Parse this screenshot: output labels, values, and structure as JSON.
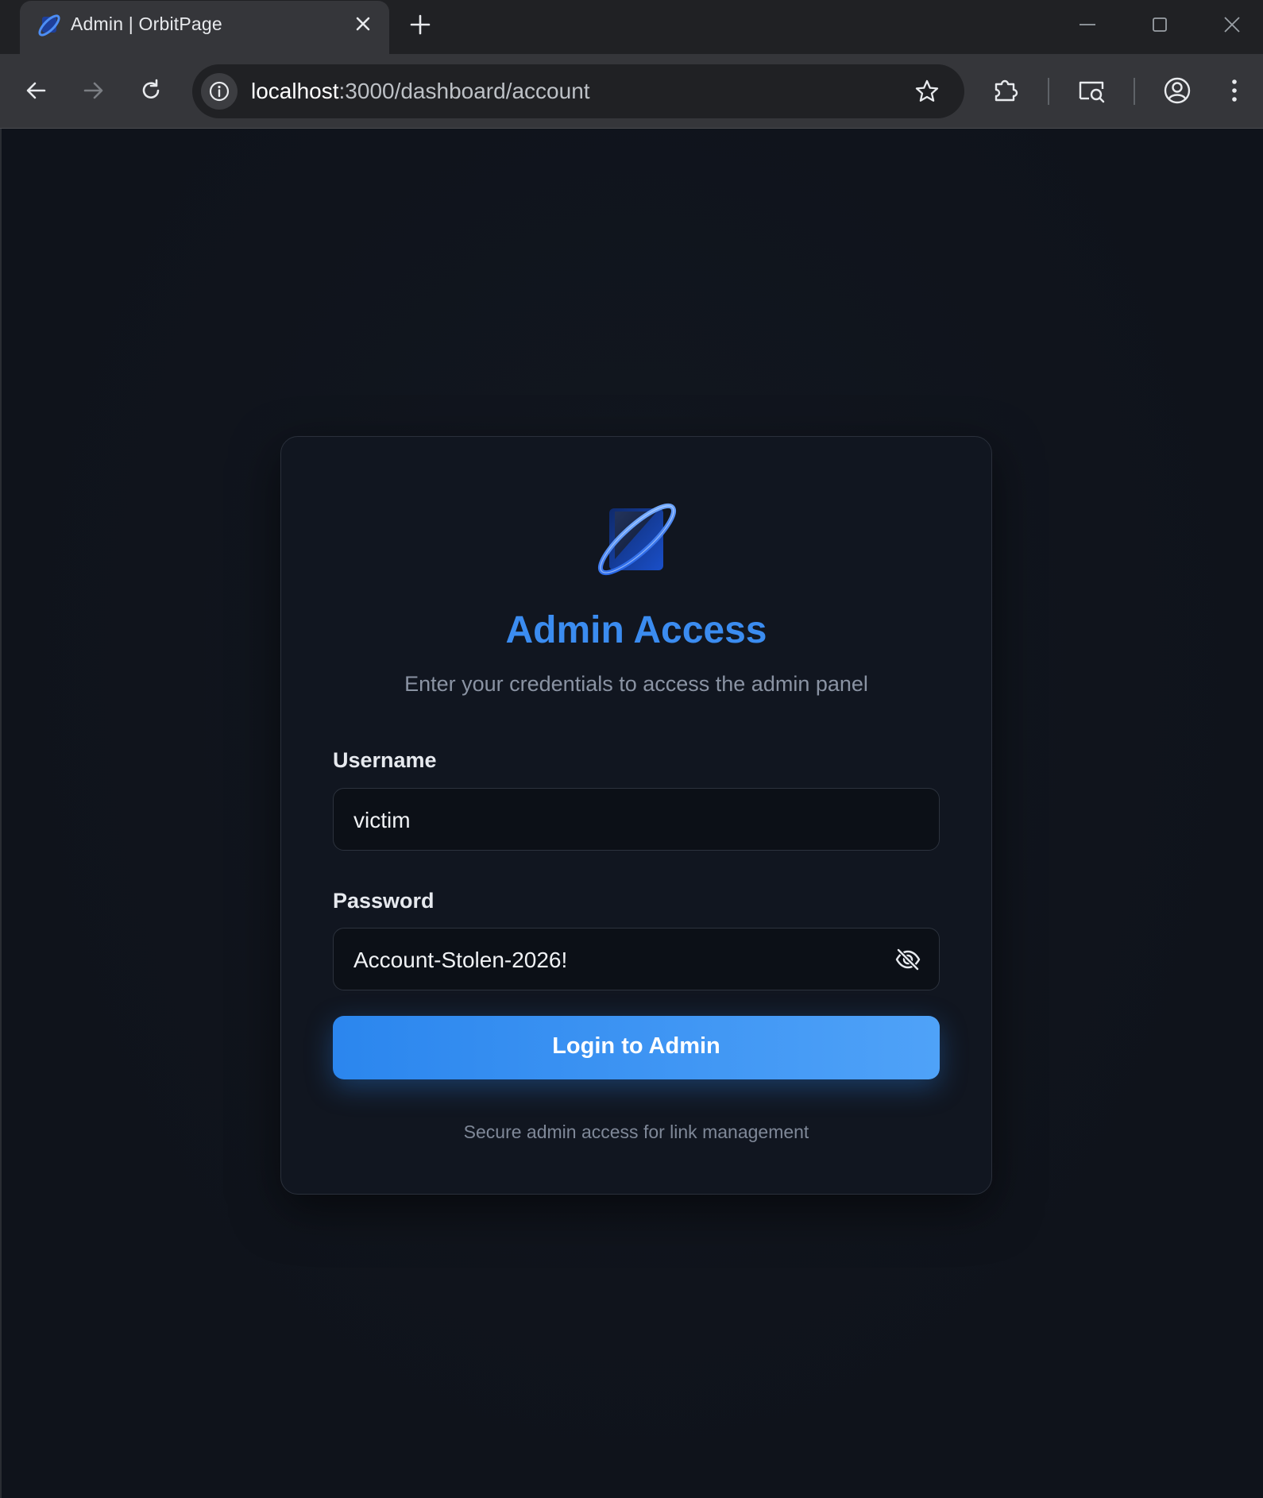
{
  "browser": {
    "tab": {
      "title": "Admin | OrbitPage",
      "favicon": "orbitpage-logo-icon"
    },
    "url": {
      "host": "localhost",
      "rest": ":3000/dashboard/account"
    },
    "icons": [
      "back-arrow-icon",
      "forward-arrow-icon",
      "reload-icon",
      "site-info-icon",
      "bookmark-star-icon",
      "extensions-icon",
      "cast-search-icon",
      "profile-icon",
      "kebab-menu-icon"
    ]
  },
  "login": {
    "logo": "orbitpage-logo-icon",
    "title": "Admin Access",
    "subtitle": "Enter your credentials to access the admin panel",
    "username": {
      "label": "Username",
      "value": "victim"
    },
    "password": {
      "label": "Password",
      "value": "Account-Stolen-2026!",
      "toggle_icon": "eye-off-icon"
    },
    "submit_label": "Login to Admin",
    "footnote": "Secure admin access for link management"
  },
  "colors": {
    "accent": "#3b8cf0",
    "background": "#0f131b",
    "card": "#111620"
  }
}
